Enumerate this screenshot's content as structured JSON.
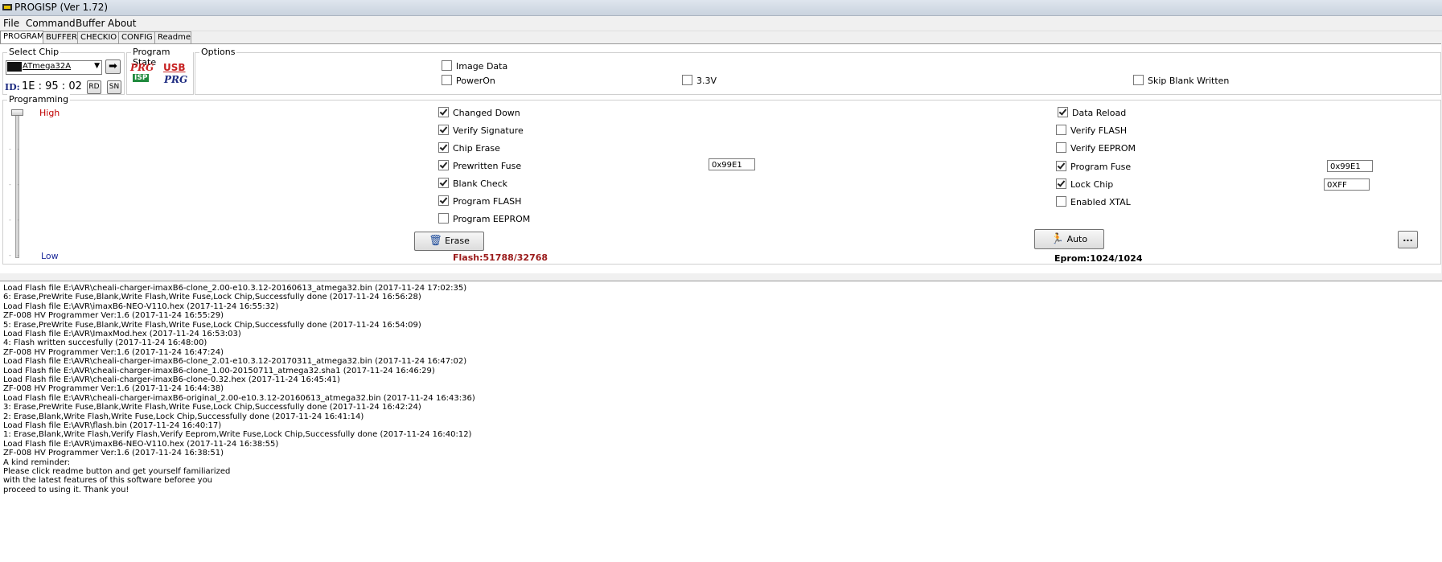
{
  "window": {
    "title": "PROGISP (Ver 1.72)"
  },
  "menu": [
    "File",
    "Command",
    "Buffer",
    "About"
  ],
  "tabs": [
    "PROGRAM",
    "BUFFER",
    "CHECKIO",
    "CONFIG",
    "Readme"
  ],
  "select_chip": {
    "legend": "Select Chip",
    "chip": "ATmega32A",
    "id_label": "ID:",
    "id_value": "1E : 95 : 02",
    "rd_label": "RD",
    "sn_label": "SN"
  },
  "program_state": {
    "legend": "Program State",
    "icon1_top": "PRG",
    "icon1_bottom": "ISP",
    "icon2_top": "USB",
    "icon2_bottom": "PRG"
  },
  "options": {
    "legend": "Options",
    "image_data": {
      "label": "Image Data",
      "checked": false
    },
    "power_on": {
      "label": "PowerOn",
      "checked": false
    },
    "v33": {
      "label": "3.3V",
      "checked": false
    },
    "skip_blank": {
      "label": "Skip Blank Written",
      "checked": false
    }
  },
  "programming": {
    "legend": "Programming",
    "high": "High",
    "low": "Low",
    "left_options": [
      {
        "label": "Changed Down",
        "checked": true
      },
      {
        "label": "Verify Signature",
        "checked": true
      },
      {
        "label": "Chip Erase",
        "checked": true
      },
      {
        "label": "Prewritten Fuse",
        "checked": true
      },
      {
        "label": "Blank Check",
        "checked": true
      },
      {
        "label": "Program FLASH",
        "checked": true
      },
      {
        "label": "Program EEPROM",
        "checked": false
      }
    ],
    "right_options": [
      {
        "label": "Data Reload",
        "checked": true
      },
      {
        "label": "Verify FLASH",
        "checked": false
      },
      {
        "label": "Verify EEPROM",
        "checked": false
      },
      {
        "label": "Program Fuse",
        "checked": true
      },
      {
        "label": "Lock Chip",
        "checked": true
      },
      {
        "label": "Enabled XTAL",
        "checked": false
      }
    ],
    "prewritten_fuse_value": "0x99E1",
    "program_fuse_value": "0x99E1",
    "lock_chip_value": "0XFF",
    "erase_label": "Erase",
    "auto_label": "Auto",
    "more_label": "...",
    "flash_status": "Flash:51788/32768",
    "eprom_status": "Eprom:1024/1024"
  },
  "log": [
    "Load Flash file E:\\AVR\\cheali-charger-imaxB6-clone_2.00-e10.3.12-20160613_atmega32.bin (2017-11-24 17:02:35)",
    "6: Erase,PreWrite Fuse,Blank,Write Flash,Write Fuse,Lock Chip,Successfully done (2017-11-24 16:56:28)",
    "Load Flash file E:\\AVR\\imaxB6-NEO-V110.hex (2017-11-24 16:55:32)",
    "ZF-008 HV Programmer Ver:1.6 (2017-11-24 16:55:29)",
    "5: Erase,PreWrite Fuse,Blank,Write Flash,Write Fuse,Lock Chip,Successfully done (2017-11-24 16:54:09)",
    "Load Flash file E:\\AVR\\ImaxMod.hex (2017-11-24 16:53:03)",
    "4: Flash written succesfully (2017-11-24 16:48:00)",
    "ZF-008 HV Programmer Ver:1.6 (2017-11-24 16:47:24)",
    "Load Flash file E:\\AVR\\cheali-charger-imaxB6-clone_2.01-e10.3.12-20170311_atmega32.bin (2017-11-24 16:47:02)",
    "Load Flash file E:\\AVR\\cheali-charger-imaxB6-clone_1.00-20150711_atmega32.sha1 (2017-11-24 16:46:29)",
    "Load Flash file E:\\AVR\\cheali-charger-imaxB6-clone-0.32.hex (2017-11-24 16:45:41)",
    "ZF-008 HV Programmer Ver:1.6 (2017-11-24 16:44:38)",
    "Load Flash file E:\\AVR\\cheali-charger-imaxB6-original_2.00-e10.3.12-20160613_atmega32.bin (2017-11-24 16:43:36)",
    "3: Erase,PreWrite Fuse,Blank,Write Flash,Write Fuse,Lock Chip,Successfully done (2017-11-24 16:42:24)",
    "2: Erase,Blank,Write Flash,Write Fuse,Lock Chip,Successfully done (2017-11-24 16:41:14)",
    "Load Flash file E:\\AVR\\flash.bin (2017-11-24 16:40:17)",
    "1: Erase,Blank,Write Flash,Verify Flash,Verify Eeprom,Write Fuse,Lock Chip,Successfully done (2017-11-24 16:40:12)",
    "Load Flash file E:\\AVR\\imaxB6-NEO-V110.hex (2017-11-24 16:38:55)",
    "ZF-008 HV Programmer Ver:1.6 (2017-11-24 16:38:51)",
    "A kind reminder:",
    "Please click readme button and get yourself familiarized",
    "with the latest features of this software beforee you",
    "proceed to using it. Thank you!"
  ]
}
